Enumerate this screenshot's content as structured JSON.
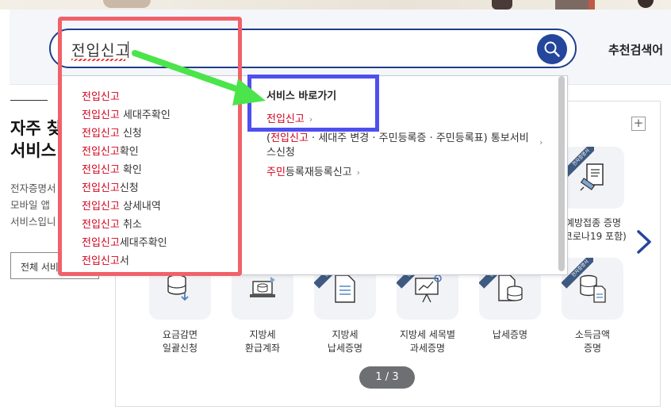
{
  "search": {
    "query": "전입신고",
    "recommend_label": "추천검색어"
  },
  "left": {
    "title_line1": "자주 찾",
    "title_line2": "서비스",
    "desc_line1": "전자증명서",
    "desc_line2": "모바일 앱",
    "desc_line3": "서비스입니",
    "button_label": "전체 서비"
  },
  "suggestions": [
    {
      "hl": "전입신고",
      "rest": ""
    },
    {
      "hl": "전입신고",
      "rest": " 세대주확인"
    },
    {
      "hl": "전입신고",
      "rest": " 신청"
    },
    {
      "hl": "전입신고",
      "rest": "확인"
    },
    {
      "hl": "전입신고",
      "rest": " 확인"
    },
    {
      "hl": "전입신고",
      "rest": "신청"
    },
    {
      "hl": "전입신고",
      "rest": " 상세내역"
    },
    {
      "hl": "전입신고",
      "rest": " 취소"
    },
    {
      "hl": "전입신고",
      "rest": "세대주확인"
    },
    {
      "hl": "전입신고",
      "rest": "서"
    }
  ],
  "shortcut": {
    "heading": "서비스 바로가기",
    "item1_hl": "전입신고",
    "item2_line1_hl": "전입신고",
    "item2_line1_rest": " · 세대주 변경 · 주민등록증 · 주민등록표) 통보서비",
    "item2_line1_prefix": "(",
    "item2_line2": "스신청",
    "item3_hl": "주민",
    "item3_rest": "등록재등록신고",
    "chevron": "›"
  },
  "services": [
    {
      "label_line1": "예방접종 증명",
      "label_line2": "(코로나19 포함)",
      "icon": "syringe-doc-icon",
      "ribbon": "전자증명서"
    },
    {
      "label_line1": "요금감면",
      "label_line2": "일괄신청",
      "icon": "database-download-icon",
      "ribbon": ""
    },
    {
      "label_line1": "지방세",
      "label_line2": "환급계좌",
      "icon": "laptop-database-icon",
      "ribbon": ""
    },
    {
      "label_line1": "지방세",
      "label_line2": "납세증명",
      "icon": "document-icon",
      "ribbon": "전자증명서"
    },
    {
      "label_line1": "지방세 세목별",
      "label_line2": "과세증명",
      "icon": "presentation-chart-icon",
      "ribbon": "전자증명서"
    },
    {
      "label_line1": "납세증명",
      "label_line2": "",
      "icon": "document-database-icon",
      "ribbon": "전자증명서"
    },
    {
      "label_line1": "소득금액",
      "label_line2": "증명",
      "icon": "database-document-icon",
      "ribbon": "전자증명서"
    }
  ],
  "pager": {
    "text": "1 / 3"
  },
  "plus_label": "+",
  "colors": {
    "brand_blue": "#24469b",
    "highlight_red": "#d0021b",
    "annotation_red": "#f0616a",
    "annotation_blue": "#4f4ff0",
    "annotation_green": "#4be44b"
  }
}
